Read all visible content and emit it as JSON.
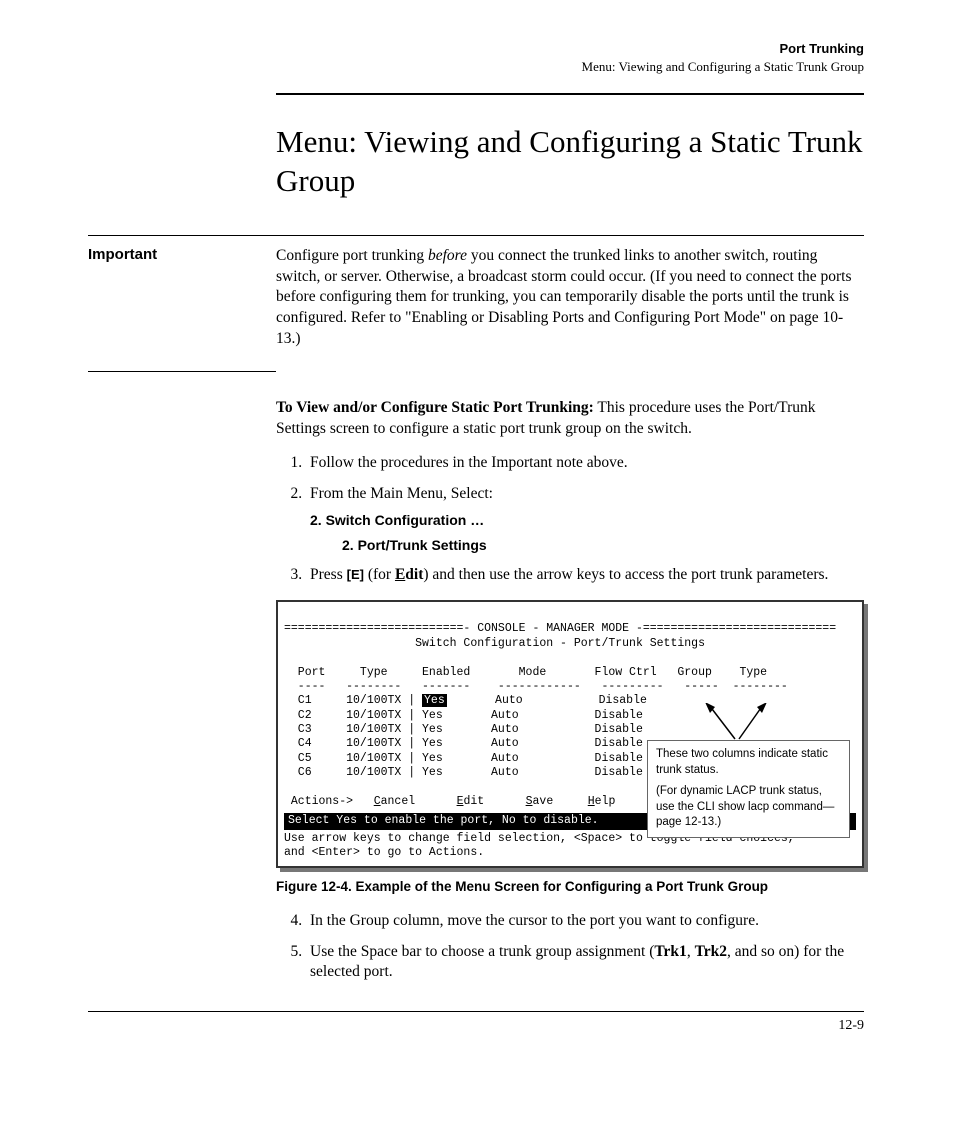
{
  "header": {
    "title": "Port Trunking",
    "subtitle": "Menu: Viewing and Configuring a Static Trunk Group"
  },
  "heading": "Menu: Viewing and Configuring a Static Trunk Group",
  "important": {
    "label": "Important",
    "text_pre": "Configure port trunking ",
    "text_em": "before",
    "text_post": " you connect the trunked links to another switch, routing switch, or server. Otherwise, a broadcast storm could occur. (If you need to connect the ports before configuring them for trunking, you can temporarily disable the ports until the trunk is configured. Refer to \"Enabling or Disabling Ports and Configuring Port Mode\" on page 10-13.)"
  },
  "intro": {
    "lead_bold": "To View and/or Configure Static Port Trunking:",
    "lead_rest": "  This procedure uses the Port/Trunk Settings screen to configure a static port trunk group on the switch."
  },
  "steps123": {
    "s1": "Follow the procedures in the Important note above.",
    "s2": "From the Main Menu, Select:",
    "s2_path1": "2. Switch Configuration …",
    "s2_path2": "2. Port/Trunk Settings",
    "s3_pre": "Press ",
    "s3_key": "[E]",
    "s3_mid": " (for ",
    "s3_edit_u": "E",
    "s3_edit_rest": "dit",
    "s3_post": ") and then use the arrow keys to access the port trunk parameters."
  },
  "console": {
    "line_dash": "==========================- CONSOLE - MANAGER MODE -============================",
    "line_sub": "                   Switch Configuration - Port/Trunk Settings",
    "head": "  Port     Type     Enabled       Mode       Flow Ctrl   Group    Type",
    "dashes": "  ----   --------   -------    ------------   ---------   -----  --------",
    "rows": [
      {
        "p": "  C1     10/100TX | ",
        "hl": "Yes",
        "rest": "       Auto           Disable"
      },
      {
        "p": "  C2     10/100TX | Yes       Auto           Disable",
        "hl": "",
        "rest": ""
      },
      {
        "p": "  C3     10/100TX | Yes       Auto           Disable",
        "hl": "",
        "rest": ""
      },
      {
        "p": "  C4     10/100TX | Yes       Auto           Disable",
        "hl": "",
        "rest": ""
      },
      {
        "p": "  C5     10/100TX | Yes       Auto           Disable",
        "hl": "",
        "rest": ""
      },
      {
        "p": "  C6     10/100TX | Yes       Auto           Disable",
        "hl": "",
        "rest": ""
      }
    ],
    "actions_pre": " Actions->   ",
    "action_cancel_u": "C",
    "action_cancel_r": "ancel",
    "action_edit_u": "E",
    "action_edit_r": "dit",
    "action_save_u": "S",
    "action_save_r": "ave",
    "action_help_u": "H",
    "action_help_r": "elp",
    "bar": "Select Yes to enable the port, No to disable.                                 ",
    "help1": "Use arrow keys to change field selection, <Space> to toggle field choices,",
    "help2": "and <Enter> to go to Actions."
  },
  "callout": {
    "line1": "These two columns indicate static trunk status.",
    "line2": "(For dynamic LACP trunk status, use the CLI show lacp command—page 12-13.)"
  },
  "figure_caption": "Figure 12-4.  Example of the Menu Screen for Configuring a Port Trunk Group",
  "steps45": {
    "s4": "In the Group column, move the cursor to the port you want to configure.",
    "s5_pre": "Use the Space bar to choose a trunk group assignment (",
    "s5_b1": "Trk1",
    "s5_mid": ", ",
    "s5_b2": "Trk2",
    "s5_post": ", and so on) for the selected port."
  },
  "page_number": "12-9"
}
